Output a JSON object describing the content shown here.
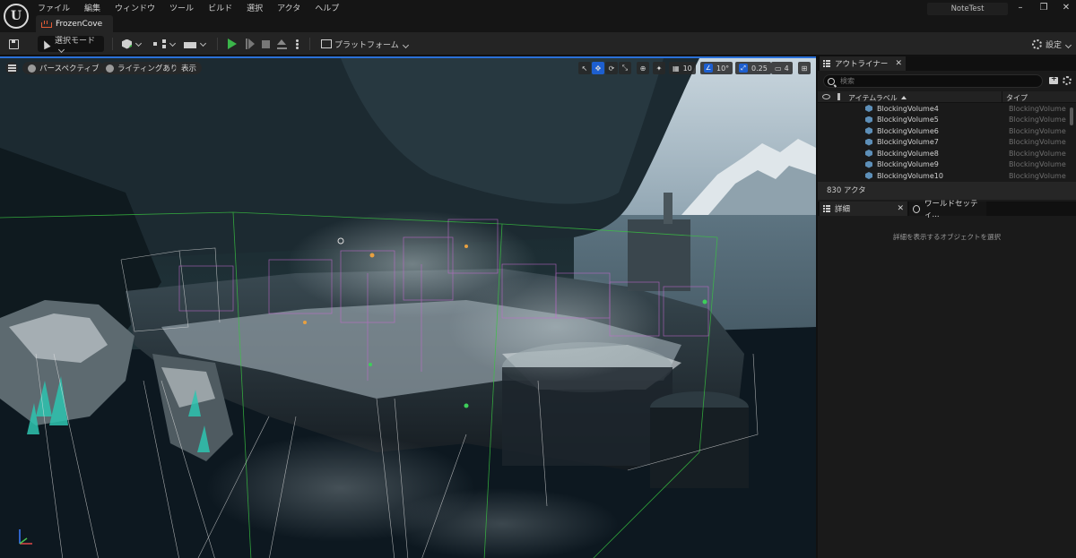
{
  "menu": [
    "ファイル",
    "編集",
    "ウィンドウ",
    "ツール",
    "ビルド",
    "選択",
    "アクタ",
    "ヘルプ"
  ],
  "document_tab": "FrozenCove",
  "project_name": "NoteTest",
  "toolbar": {
    "mode_label": "選択モード",
    "platform_label": "プラットフォーム",
    "settings_label": "設定"
  },
  "viewport": {
    "perspective_label": "パースペクティブ",
    "lighting_label": "ライティングあり",
    "show_label": "表示",
    "grid_snap": "10",
    "rotation_snap": "10°",
    "scale_snap": "0.25",
    "camera_speed": "4"
  },
  "outliner": {
    "tab_label": "アウトライナー",
    "search_placeholder": "検索",
    "col_label": "アイテムラベル",
    "col_type": "タイプ",
    "rows": [
      {
        "name": "BlockingVolume4",
        "type": "BlockingVolume"
      },
      {
        "name": "BlockingVolume5",
        "type": "BlockingVolume"
      },
      {
        "name": "BlockingVolume6",
        "type": "BlockingVolume"
      },
      {
        "name": "BlockingVolume7",
        "type": "BlockingVolume"
      },
      {
        "name": "BlockingVolume8",
        "type": "BlockingVolume"
      },
      {
        "name": "BlockingVolume9",
        "type": "BlockingVolume"
      },
      {
        "name": "BlockingVolume10",
        "type": "BlockingVolume"
      }
    ],
    "actor_count": "830 アクタ"
  },
  "details": {
    "tab_label": "詳細",
    "world_tab_label": "ワールドセッティ...",
    "empty_message": "詳細を表示するオブジェクトを選択"
  },
  "colors": {
    "accent": "#1d5fd0",
    "play": "#3bb54a"
  }
}
